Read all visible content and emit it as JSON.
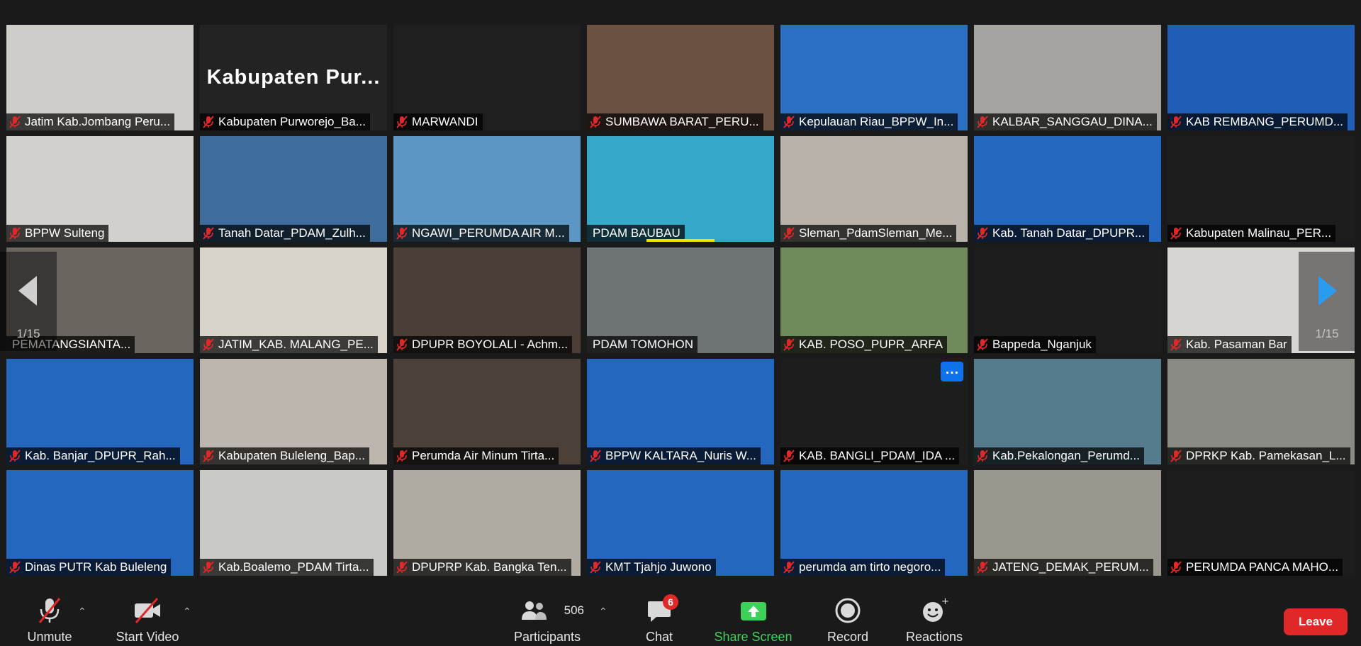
{
  "gallery": {
    "page_left": "1/15",
    "page_right": "1/15",
    "tiles": [
      {
        "name": "Jatim Kab.Jombang Peru...",
        "muted": true,
        "bg": "#cfcdc9"
      },
      {
        "name": "Kabupaten Purworejo_Ba...",
        "muted": true,
        "bg": "#232323",
        "display_text": "Kabupaten  Pur..."
      },
      {
        "name": "MARWANDI",
        "muted": true,
        "bg": "#1f1f1f"
      },
      {
        "name": "SUMBAWA BARAT_PERU...",
        "muted": true,
        "bg": "#6a5140"
      },
      {
        "name": "Kepulauan Riau_BPPW_In...",
        "muted": true,
        "bg": "#2b6fc4"
      },
      {
        "name": "KALBAR_SANGGAU_DINA...",
        "muted": true,
        "bg": "#a6a4a0"
      },
      {
        "name": "KAB REMBANG_PERUMD...",
        "muted": true,
        "bg": "#1f5fb8"
      },
      {
        "name": "BPPW Sulteng",
        "muted": true,
        "bg": "#d2d0cc"
      },
      {
        "name": "Tanah Datar_PDAM_Zulh...",
        "muted": true,
        "bg": "#3e6d9c"
      },
      {
        "name": "NGAWI_PERUMDA AIR M...",
        "muted": true,
        "bg": "#5b96c4"
      },
      {
        "name": "PDAM BAUBAU",
        "muted": false,
        "speaking": true,
        "bg": "#35a7c9"
      },
      {
        "name": "Sleman_PdamSleman_Me...",
        "muted": true,
        "bg": "#b8b2aa"
      },
      {
        "name": "Kab. Tanah Datar_DPUPR...",
        "muted": true,
        "bg": "#2467bf"
      },
      {
        "name": "Kabupaten Malinau_PER...",
        "muted": true,
        "bg": "#1d1d1d"
      },
      {
        "name": "PEMATANGSIANTA...",
        "muted": false,
        "bg": "#6b6560"
      },
      {
        "name": "JATIM_KAB. MALANG_PE...",
        "muted": true,
        "bg": "#d8d4c9"
      },
      {
        "name": "DPUPR BOYOLALI - Achm...",
        "muted": true,
        "bg": "#4a3e36"
      },
      {
        "name": "PDAM TOMOHON",
        "muted": false,
        "bg": "#6e7376"
      },
      {
        "name": "KAB. POSO_PUPR_ARFA",
        "muted": true,
        "bg": "#6f8a5b"
      },
      {
        "name": "Bappeda_Nganjuk",
        "muted": true,
        "bg": "#1d1d1d"
      },
      {
        "name": "Kab. Pasaman Bar",
        "muted": true,
        "bg": "#d8d6d2"
      },
      {
        "name": "Kab. Banjar_DPUPR_Rah...",
        "muted": true,
        "bg": "#2467bf"
      },
      {
        "name": "Kabupaten Buleleng_Bap...",
        "muted": true,
        "bg": "#bdb6ae"
      },
      {
        "name": "Perumda Air Minum Tirta...",
        "muted": true,
        "bg": "#4c4138"
      },
      {
        "name": "BPPW KALTARA_Nuris W...",
        "muted": true,
        "bg": "#2467bf"
      },
      {
        "name": "KAB. BANGLI_PDAM_IDA ...",
        "muted": true,
        "bg": "#1d1d1d"
      },
      {
        "name": "Kab.Pekalongan_Perumd...",
        "muted": true,
        "bg": "#557b8d"
      },
      {
        "name": "DPRKP Kab. Pamekasan_L...",
        "muted": true,
        "bg": "#8a8a84"
      },
      {
        "name": "Dinas PUTR Kab Buleleng",
        "muted": true,
        "bg": "#2467bf"
      },
      {
        "name": "Kab.Boalemo_PDAM Tirta...",
        "muted": true,
        "bg": "#c9c9c6"
      },
      {
        "name": "DPUPRP Kab. Bangka Ten...",
        "muted": true,
        "bg": "#b0aba2"
      },
      {
        "name": "KMT Tjahjo Juwono",
        "muted": true,
        "bg": "#2467bf"
      },
      {
        "name": "perumda am tirto negoro...",
        "muted": true,
        "bg": "#2467bf"
      },
      {
        "name": "JATENG_DEMAK_PERUM...",
        "muted": true,
        "bg": "#9a988e"
      },
      {
        "name": "PERUMDA PANCA MAHO...",
        "muted": true,
        "bg": "#1d1d1d"
      }
    ]
  },
  "toolbar": {
    "unmute": "Unmute",
    "start_video": "Start Video",
    "participants": "Participants",
    "participant_count": "506",
    "chat": "Chat",
    "chat_badge": "6",
    "share_screen": "Share Screen",
    "record": "Record",
    "reactions": "Reactions",
    "leave": "Leave"
  },
  "colors": {
    "background": "#1a1a1a",
    "leave": "#e02828",
    "share": "#3ed15a",
    "mute_icon": "#e02828",
    "speaking": "#f4e200",
    "accent": "#0e72ed"
  },
  "icons": [
    "mic-muted-icon",
    "video-off-icon",
    "participants-icon",
    "chat-icon",
    "share-screen-icon",
    "record-icon",
    "reactions-icon",
    "chevron-left-icon",
    "chevron-right-icon",
    "more-icon"
  ]
}
